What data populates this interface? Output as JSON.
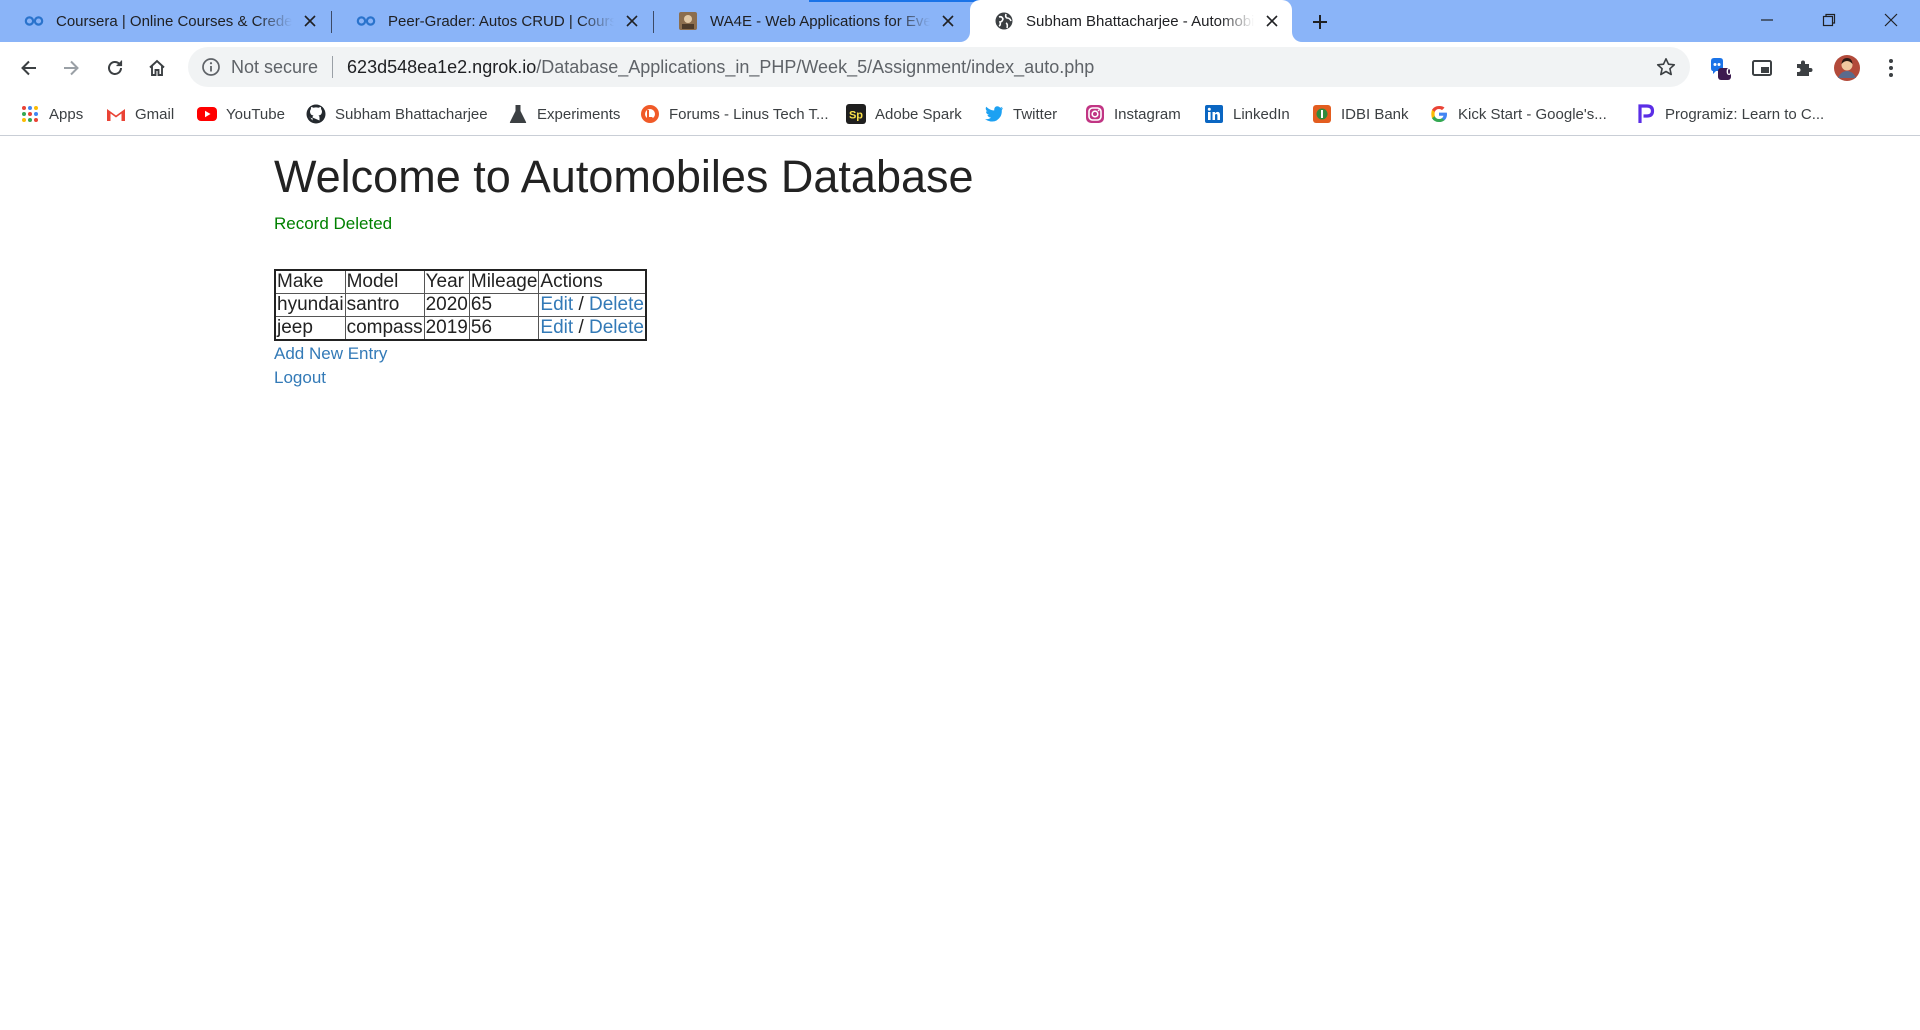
{
  "browser": {
    "tabs": [
      {
        "title": "Coursera | Online Courses & Credentials",
        "icon": "coursera-icon",
        "active": false
      },
      {
        "title": "Peer-Grader: Autos CRUD | Coursera",
        "icon": "coursera-icon",
        "active": false
      },
      {
        "title": "WA4E - Web Applications for Everybody",
        "icon": "wa4e-icon",
        "active": false
      },
      {
        "title": "Subham Bhattacharjee - Automobiles",
        "icon": "globe-icon",
        "active": true
      }
    ],
    "address_bar": {
      "security_label": "Not secure",
      "host": "623d548ea1e2.ngrok.io",
      "path": "/Database_Applications_in_PHP/Week_5/Assignment/index_auto.php"
    },
    "extension_badge": "0",
    "bookmarks": [
      {
        "label": "Apps",
        "icon": "apps-grid-icon"
      },
      {
        "label": "Gmail",
        "icon": "gmail-icon"
      },
      {
        "label": "YouTube",
        "icon": "youtube-icon"
      },
      {
        "label": "Subham Bhattacharjee",
        "icon": "github-icon"
      },
      {
        "label": "Experiments",
        "icon": "flask-icon"
      },
      {
        "label": "Forums - Linus Tech T...",
        "icon": "linus-tech-tips-icon"
      },
      {
        "label": "Adobe Spark",
        "icon": "adobe-spark-icon"
      },
      {
        "label": "Twitter",
        "icon": "twitter-icon"
      },
      {
        "label": "Instagram",
        "icon": "instagram-icon"
      },
      {
        "label": "LinkedIn",
        "icon": "linkedin-icon"
      },
      {
        "label": "IDBI Bank",
        "icon": "idbi-bank-icon"
      },
      {
        "label": "Kick Start - Google's...",
        "icon": "google-icon"
      },
      {
        "label": "Programiz: Learn to C...",
        "icon": "programiz-icon"
      }
    ],
    "colors": {
      "tabstrip": "#8ab4f8",
      "accent": "#1a73e8"
    }
  },
  "page": {
    "title": "Welcome to Automobiles Database",
    "flash_message": "Record Deleted",
    "flash_color": "#008000",
    "table": {
      "headers": [
        "Make",
        "Model",
        "Year",
        "Mileage",
        "Actions"
      ],
      "rows": [
        {
          "make": "hyundai",
          "model": "santro",
          "year": "2020",
          "mileage": "65",
          "edit": "Edit",
          "separator": "/",
          "delete": "Delete"
        },
        {
          "make": "jeep",
          "model": "compass",
          "year": "2019",
          "mileage": "56",
          "edit": "Edit",
          "separator": "/",
          "delete": "Delete"
        }
      ]
    },
    "add_link": "Add New Entry",
    "logout_link": "Logout",
    "link_color": "#337ab7"
  }
}
